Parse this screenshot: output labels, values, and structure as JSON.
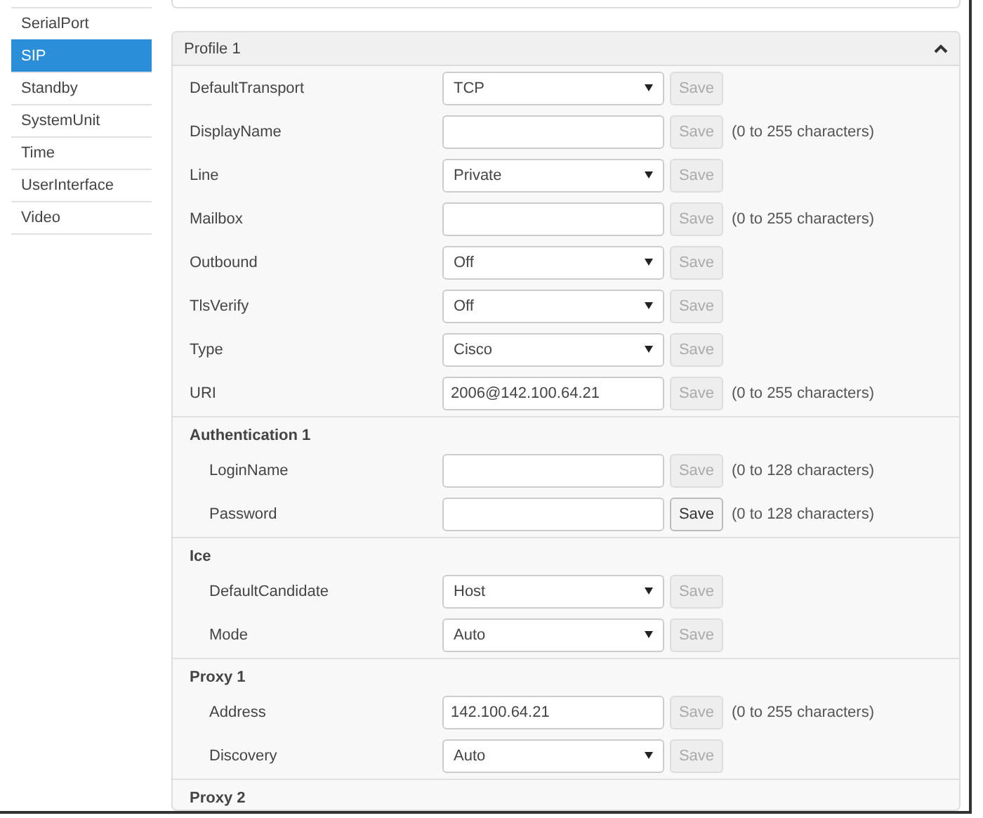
{
  "sidebar": {
    "items": [
      {
        "label": "SerialPort",
        "selected": false
      },
      {
        "label": "SIP",
        "selected": true
      },
      {
        "label": "Standby",
        "selected": false
      },
      {
        "label": "SystemUnit",
        "selected": false
      },
      {
        "label": "Time",
        "selected": false
      },
      {
        "label": "UserInterface",
        "selected": false
      },
      {
        "label": "Video",
        "selected": false
      }
    ]
  },
  "profile": {
    "title": "Profile 1",
    "expanded": true,
    "sections": [
      {
        "rows": [
          {
            "label": "DefaultTransport",
            "kind": "select",
            "value": "TCP",
            "save": "Save",
            "save_enabled": false
          },
          {
            "label": "DisplayName",
            "kind": "text",
            "save": "Save",
            "save_enabled": false,
            "hint": "(0 to 255 characters)"
          },
          {
            "label": "Line",
            "kind": "select",
            "value": "Private",
            "save": "Save",
            "save_enabled": false
          },
          {
            "label": "Mailbox",
            "kind": "text",
            "save": "Save",
            "save_enabled": false,
            "hint": "(0 to 255 characters)"
          },
          {
            "label": "Outbound",
            "kind": "select",
            "value": "Off",
            "save": "Save",
            "save_enabled": false
          },
          {
            "label": "TlsVerify",
            "kind": "select",
            "value": "Off",
            "save": "Save",
            "save_enabled": false
          },
          {
            "label": "Type",
            "kind": "select",
            "value": "Cisco",
            "save": "Save",
            "save_enabled": false
          },
          {
            "label": "URI",
            "kind": "text",
            "value": "2006@142.100.64.21",
            "save": "Save",
            "save_enabled": false,
            "hint": "(0 to 255 characters)"
          }
        ]
      },
      {
        "heading": "Authentication 1",
        "rows": [
          {
            "label": "LoginName",
            "kind": "text",
            "save": "Save",
            "save_enabled": false,
            "hint": "(0 to 128 characters)"
          },
          {
            "label": "Password",
            "kind": "text",
            "save": "Save",
            "save_enabled": true,
            "hint": "(0 to 128 characters)"
          }
        ]
      },
      {
        "heading": "Ice",
        "rows": [
          {
            "label": "DefaultCandidate",
            "kind": "select",
            "value": "Host",
            "save": "Save",
            "save_enabled": false
          },
          {
            "label": "Mode",
            "kind": "select",
            "value": "Auto",
            "save": "Save",
            "save_enabled": false
          }
        ]
      },
      {
        "heading": "Proxy 1",
        "rows": [
          {
            "label": "Address",
            "kind": "text",
            "value": "142.100.64.21",
            "save": "Save",
            "save_enabled": false,
            "hint": "(0 to 255 characters)"
          },
          {
            "label": "Discovery",
            "kind": "select",
            "value": "Auto",
            "save": "Save",
            "save_enabled": false
          }
        ]
      },
      {
        "heading": "Proxy 2"
      }
    ]
  }
}
